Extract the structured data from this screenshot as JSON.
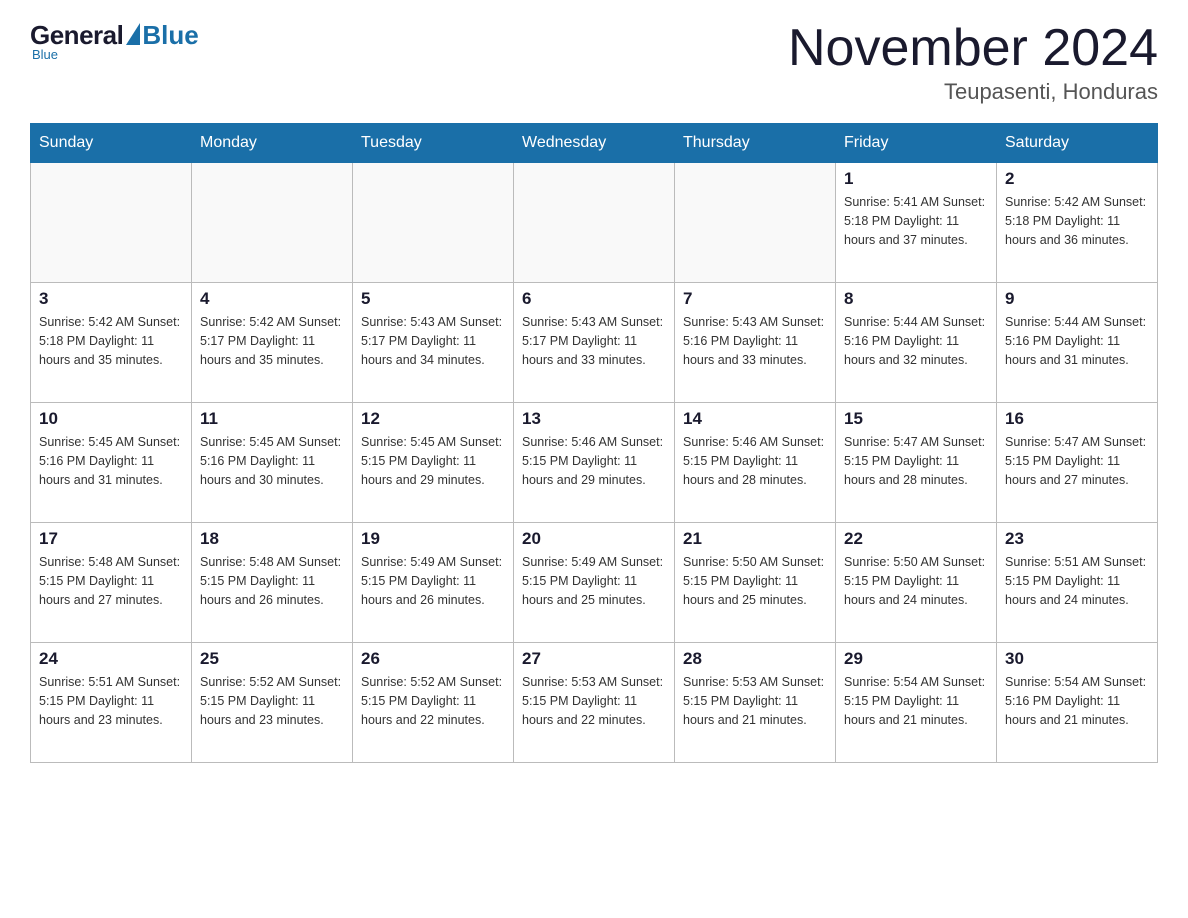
{
  "logo": {
    "general": "General",
    "blue": "Blue",
    "subtitle": "Blue"
  },
  "header": {
    "month": "November 2024",
    "location": "Teupasenti, Honduras"
  },
  "weekdays": [
    "Sunday",
    "Monday",
    "Tuesday",
    "Wednesday",
    "Thursday",
    "Friday",
    "Saturday"
  ],
  "weeks": [
    [
      {
        "day": "",
        "info": ""
      },
      {
        "day": "",
        "info": ""
      },
      {
        "day": "",
        "info": ""
      },
      {
        "day": "",
        "info": ""
      },
      {
        "day": "",
        "info": ""
      },
      {
        "day": "1",
        "info": "Sunrise: 5:41 AM\nSunset: 5:18 PM\nDaylight: 11 hours\nand 37 minutes."
      },
      {
        "day": "2",
        "info": "Sunrise: 5:42 AM\nSunset: 5:18 PM\nDaylight: 11 hours\nand 36 minutes."
      }
    ],
    [
      {
        "day": "3",
        "info": "Sunrise: 5:42 AM\nSunset: 5:18 PM\nDaylight: 11 hours\nand 35 minutes."
      },
      {
        "day": "4",
        "info": "Sunrise: 5:42 AM\nSunset: 5:17 PM\nDaylight: 11 hours\nand 35 minutes."
      },
      {
        "day": "5",
        "info": "Sunrise: 5:43 AM\nSunset: 5:17 PM\nDaylight: 11 hours\nand 34 minutes."
      },
      {
        "day": "6",
        "info": "Sunrise: 5:43 AM\nSunset: 5:17 PM\nDaylight: 11 hours\nand 33 minutes."
      },
      {
        "day": "7",
        "info": "Sunrise: 5:43 AM\nSunset: 5:16 PM\nDaylight: 11 hours\nand 33 minutes."
      },
      {
        "day": "8",
        "info": "Sunrise: 5:44 AM\nSunset: 5:16 PM\nDaylight: 11 hours\nand 32 minutes."
      },
      {
        "day": "9",
        "info": "Sunrise: 5:44 AM\nSunset: 5:16 PM\nDaylight: 11 hours\nand 31 minutes."
      }
    ],
    [
      {
        "day": "10",
        "info": "Sunrise: 5:45 AM\nSunset: 5:16 PM\nDaylight: 11 hours\nand 31 minutes."
      },
      {
        "day": "11",
        "info": "Sunrise: 5:45 AM\nSunset: 5:16 PM\nDaylight: 11 hours\nand 30 minutes."
      },
      {
        "day": "12",
        "info": "Sunrise: 5:45 AM\nSunset: 5:15 PM\nDaylight: 11 hours\nand 29 minutes."
      },
      {
        "day": "13",
        "info": "Sunrise: 5:46 AM\nSunset: 5:15 PM\nDaylight: 11 hours\nand 29 minutes."
      },
      {
        "day": "14",
        "info": "Sunrise: 5:46 AM\nSunset: 5:15 PM\nDaylight: 11 hours\nand 28 minutes."
      },
      {
        "day": "15",
        "info": "Sunrise: 5:47 AM\nSunset: 5:15 PM\nDaylight: 11 hours\nand 28 minutes."
      },
      {
        "day": "16",
        "info": "Sunrise: 5:47 AM\nSunset: 5:15 PM\nDaylight: 11 hours\nand 27 minutes."
      }
    ],
    [
      {
        "day": "17",
        "info": "Sunrise: 5:48 AM\nSunset: 5:15 PM\nDaylight: 11 hours\nand 27 minutes."
      },
      {
        "day": "18",
        "info": "Sunrise: 5:48 AM\nSunset: 5:15 PM\nDaylight: 11 hours\nand 26 minutes."
      },
      {
        "day": "19",
        "info": "Sunrise: 5:49 AM\nSunset: 5:15 PM\nDaylight: 11 hours\nand 26 minutes."
      },
      {
        "day": "20",
        "info": "Sunrise: 5:49 AM\nSunset: 5:15 PM\nDaylight: 11 hours\nand 25 minutes."
      },
      {
        "day": "21",
        "info": "Sunrise: 5:50 AM\nSunset: 5:15 PM\nDaylight: 11 hours\nand 25 minutes."
      },
      {
        "day": "22",
        "info": "Sunrise: 5:50 AM\nSunset: 5:15 PM\nDaylight: 11 hours\nand 24 minutes."
      },
      {
        "day": "23",
        "info": "Sunrise: 5:51 AM\nSunset: 5:15 PM\nDaylight: 11 hours\nand 24 minutes."
      }
    ],
    [
      {
        "day": "24",
        "info": "Sunrise: 5:51 AM\nSunset: 5:15 PM\nDaylight: 11 hours\nand 23 minutes."
      },
      {
        "day": "25",
        "info": "Sunrise: 5:52 AM\nSunset: 5:15 PM\nDaylight: 11 hours\nand 23 minutes."
      },
      {
        "day": "26",
        "info": "Sunrise: 5:52 AM\nSunset: 5:15 PM\nDaylight: 11 hours\nand 22 minutes."
      },
      {
        "day": "27",
        "info": "Sunrise: 5:53 AM\nSunset: 5:15 PM\nDaylight: 11 hours\nand 22 minutes."
      },
      {
        "day": "28",
        "info": "Sunrise: 5:53 AM\nSunset: 5:15 PM\nDaylight: 11 hours\nand 21 minutes."
      },
      {
        "day": "29",
        "info": "Sunrise: 5:54 AM\nSunset: 5:15 PM\nDaylight: 11 hours\nand 21 minutes."
      },
      {
        "day": "30",
        "info": "Sunrise: 5:54 AM\nSunset: 5:16 PM\nDaylight: 11 hours\nand 21 minutes."
      }
    ]
  ]
}
